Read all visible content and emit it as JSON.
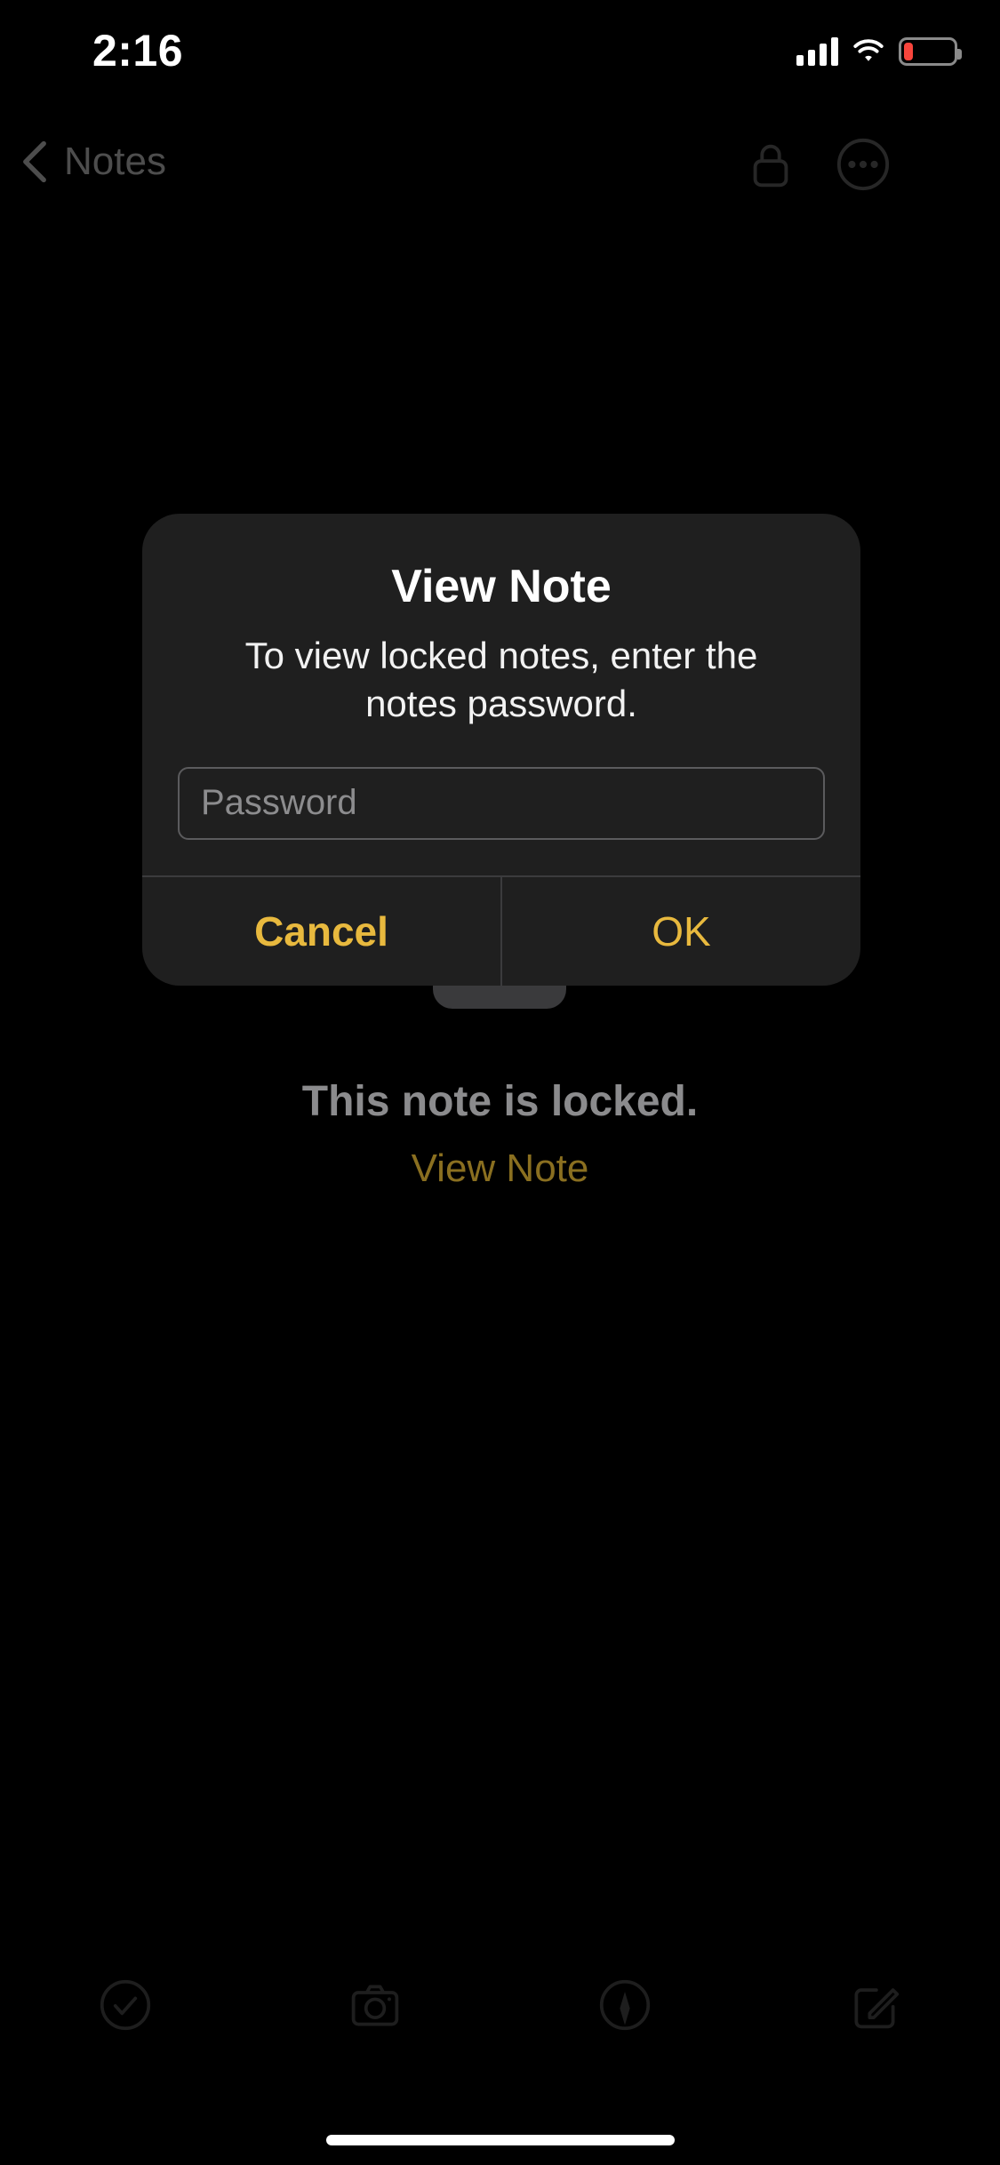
{
  "status_bar": {
    "time": "2:16",
    "signal_icon": "cellular-signal-icon",
    "signal_bars": 4,
    "wifi_icon": "wifi-icon",
    "battery_icon": "battery-low-icon",
    "battery_level_percent": 18,
    "battery_color": "#F8453C"
  },
  "nav_bar": {
    "back_label": "Notes",
    "back_icon": "chevron-left-icon",
    "lock_icon": "lock-icon",
    "more_icon": "ellipsis-circle-icon",
    "dimmed_color": "#4D4D4D"
  },
  "note_content": {
    "lock_placeholder_icon": "large-lock-icon",
    "locked_message": "This note is locked.",
    "view_note_link": "View Note",
    "locked_message_color": "#8B8B8D",
    "view_note_link_color": "#8A6F20"
  },
  "alert": {
    "title": "View Note",
    "message": "To view locked notes, enter the notes password.",
    "password_field": {
      "placeholder": "Password",
      "value": ""
    },
    "buttons": [
      {
        "label": "Cancel",
        "role": "cancel"
      },
      {
        "label": "OK",
        "role": "default"
      }
    ],
    "accent_color": "#E8B93E",
    "background_color": "#1F1F1F"
  },
  "toolbar": {
    "items": [
      {
        "icon": "checklist-circle-icon",
        "label": "Checklist"
      },
      {
        "icon": "camera-icon",
        "label": "Camera"
      },
      {
        "icon": "markup-pen-circle-icon",
        "label": "Markup"
      },
      {
        "icon": "compose-icon",
        "label": "Compose"
      }
    ],
    "dimmed_color": "#1E1E1E"
  },
  "home_indicator": {
    "visible": true,
    "color": "#FFFFFF"
  }
}
